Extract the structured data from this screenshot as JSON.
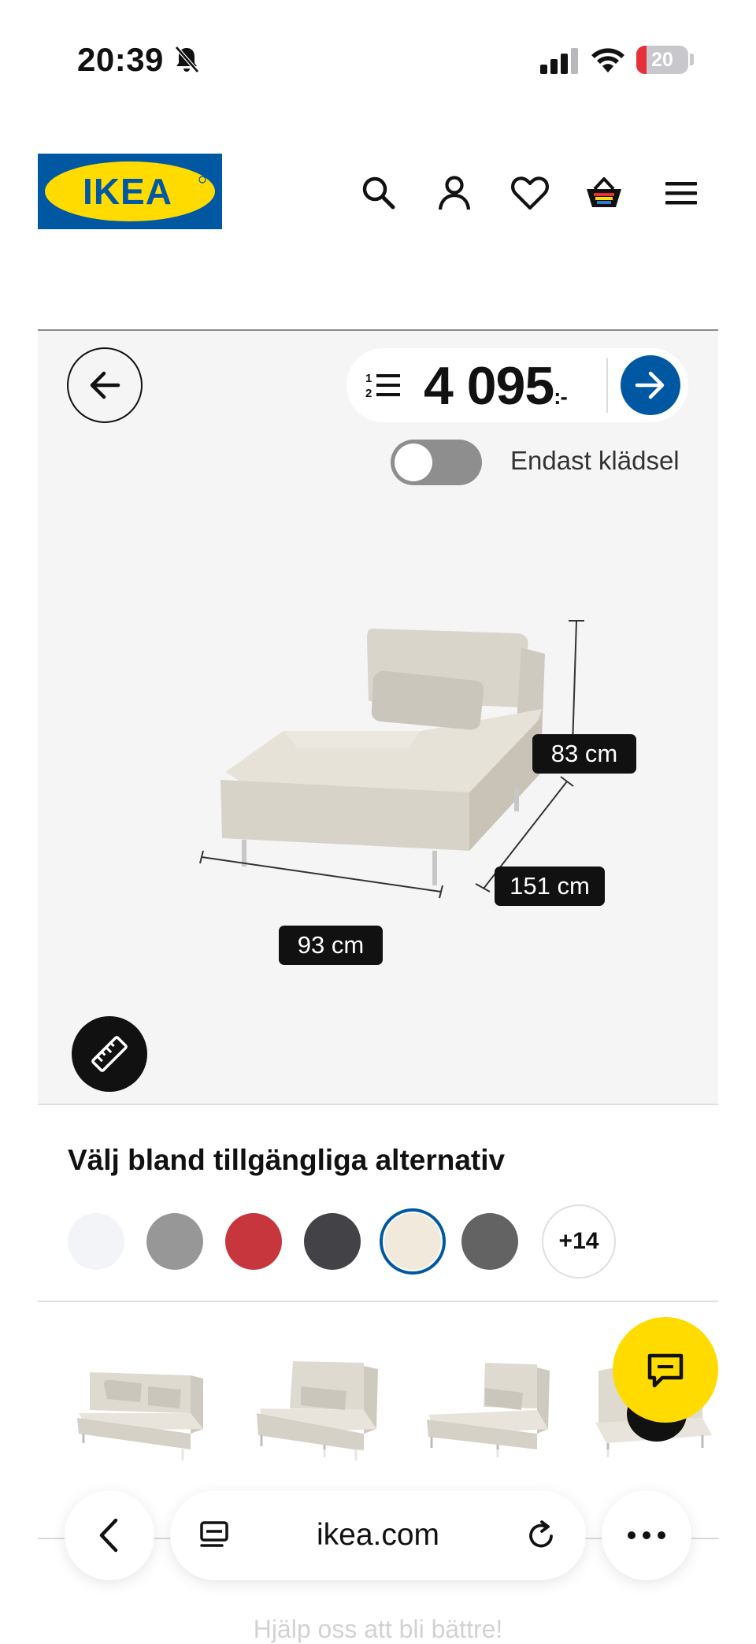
{
  "status_bar": {
    "time": "20:39",
    "battery_level": "20",
    "battery_fraction": 0.2,
    "icons": [
      "bell-muted-icon",
      "cellular-signal-icon",
      "wifi-icon",
      "battery-icon"
    ]
  },
  "header": {
    "logo_text": "IKEA",
    "icons": [
      "search-icon",
      "account-icon",
      "heart-icon",
      "basket-icon",
      "menu-icon"
    ],
    "brand_colors": {
      "blue": "#0058a3",
      "yellow": "#ffdb00"
    }
  },
  "viewer": {
    "price_value": "4 095",
    "price_suffix": ":-",
    "toggle_label": "Endast klädsel",
    "toggle_on": false,
    "dimensions": {
      "height": "83 cm",
      "depth": "151 cm",
      "width": "93 cm"
    }
  },
  "options": {
    "title": "Välj bland tillgängliga alternativ",
    "swatches": [
      {
        "name": "white",
        "color": "#f3f4f7"
      },
      {
        "name": "light-grey",
        "color": "#979797"
      },
      {
        "name": "red",
        "color": "#c8363d"
      },
      {
        "name": "dark-grey",
        "color": "#434347"
      },
      {
        "name": "beige",
        "color": "#f1e9dc",
        "selected": true
      },
      {
        "name": "medium-grey",
        "color": "#636363"
      }
    ],
    "more_label": "+14"
  },
  "browser": {
    "url": "ikea.com",
    "feedback_text": "Hjälp oss att bli bättre!"
  }
}
